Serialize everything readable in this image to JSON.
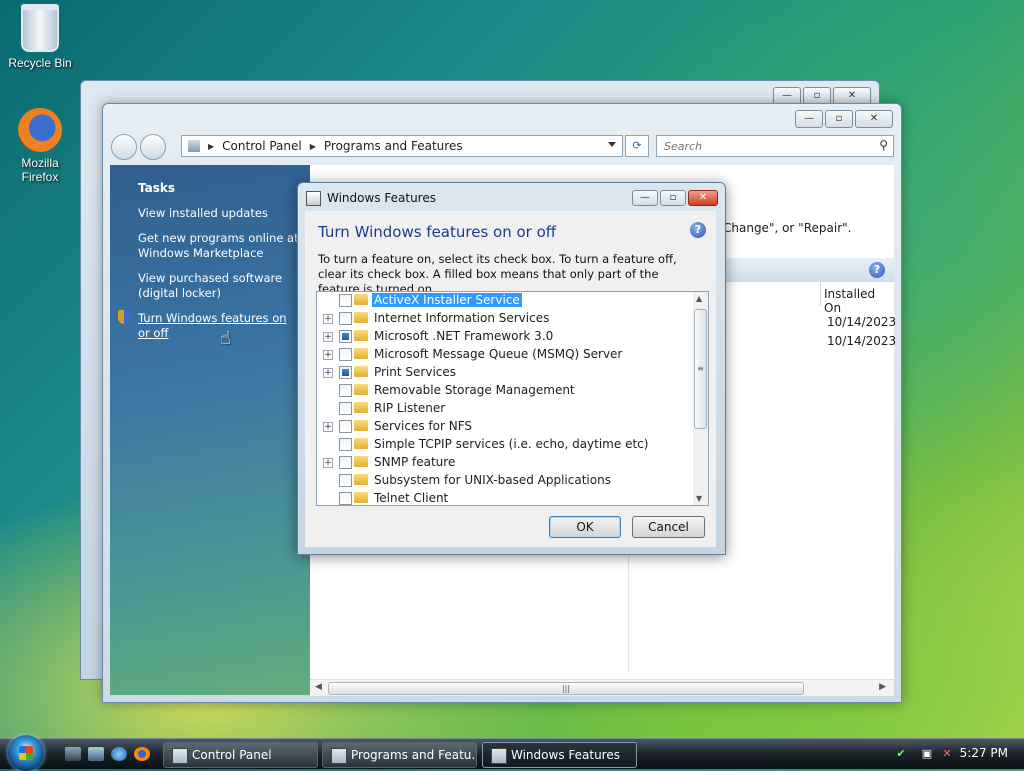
{
  "desktop": {
    "recycle_bin": "Recycle Bin",
    "firefox_line1": "Mozilla",
    "firefox_line2": "Firefox"
  },
  "main_window": {
    "breadcrumb": [
      "Control Panel",
      "Programs and Features"
    ],
    "search_placeholder": "Search",
    "tasks_title": "Tasks",
    "tasks": [
      "View installed updates",
      "Get new programs online at Windows Marketplace",
      "View purchased software (digital locker)",
      "Turn Windows features on or off"
    ],
    "partial_hint": "Change\", or \"Repair\".",
    "column_installed_on": "Installed On",
    "dates": [
      "10/14/2023",
      "10/14/2023"
    ]
  },
  "dialog": {
    "title": "Windows Features",
    "heading": "Turn Windows features on or off",
    "description": "To turn a feature on, select its check box. To turn a feature off, clear its check box. A filled box means that only part of the feature is turned on.",
    "features": [
      {
        "label": "ActiveX Installer Service",
        "expandable": false,
        "state": "off",
        "selected": true
      },
      {
        "label": "Internet Information Services",
        "expandable": true,
        "state": "off",
        "selected": false
      },
      {
        "label": "Microsoft .NET Framework 3.0",
        "expandable": true,
        "state": "partial",
        "selected": false
      },
      {
        "label": "Microsoft Message Queue (MSMQ) Server",
        "expandable": true,
        "state": "off",
        "selected": false
      },
      {
        "label": "Print Services",
        "expandable": true,
        "state": "partial",
        "selected": false
      },
      {
        "label": "Removable Storage Management",
        "expandable": false,
        "state": "off",
        "selected": false
      },
      {
        "label": "RIP Listener",
        "expandable": false,
        "state": "off",
        "selected": false
      },
      {
        "label": "Services for NFS",
        "expandable": true,
        "state": "off",
        "selected": false
      },
      {
        "label": "Simple TCPIP services (i.e. echo, daytime etc)",
        "expandable": false,
        "state": "off",
        "selected": false
      },
      {
        "label": "SNMP feature",
        "expandable": true,
        "state": "off",
        "selected": false
      },
      {
        "label": "Subsystem for UNIX-based Applications",
        "expandable": false,
        "state": "off",
        "selected": false
      },
      {
        "label": "Telnet Client",
        "expandable": false,
        "state": "off",
        "selected": false
      }
    ],
    "ok_label": "OK",
    "cancel_label": "Cancel"
  },
  "taskbar": {
    "buttons": [
      "Control Panel",
      "Programs and Featu...",
      "Windows Features"
    ],
    "clock": "5:27 PM"
  }
}
